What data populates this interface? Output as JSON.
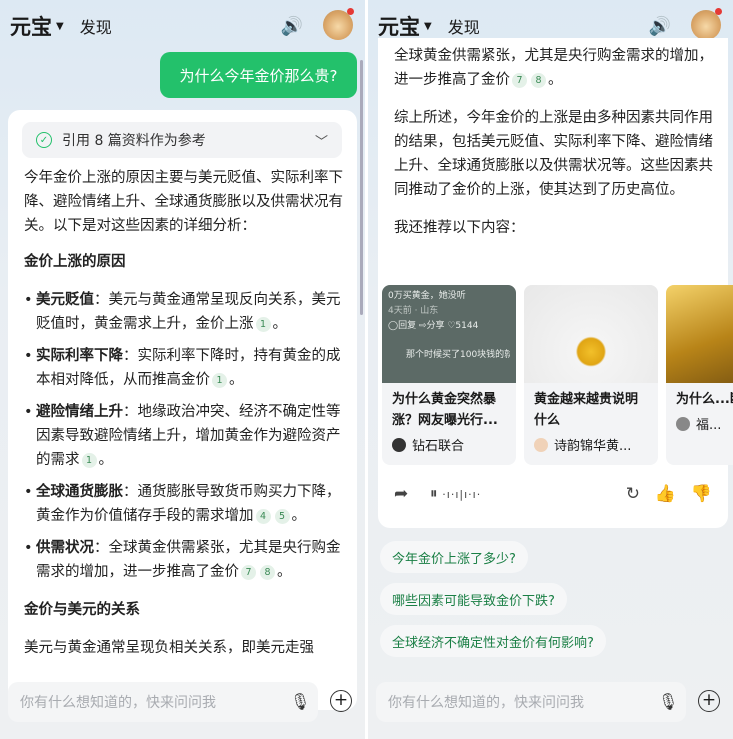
{
  "header": {
    "logo": "元宝",
    "discover": "发现"
  },
  "user_question": "为什么今年金价那么贵?",
  "reference": {
    "label": "引用 8 篇资料作为参考"
  },
  "intro": "今年金价上涨的原因主要与美元贬值、实际利率下降、避险情绪上升、全球通货膨胀以及供需状况有关。以下是对这些因素的详细分析：",
  "section1": "金价上涨的原因",
  "reasons": [
    {
      "title": "美元贬值",
      "text": "：美元与黄金通常呈现反向关系，美元贬值时，黄金需求上升，金价上涨",
      "cites": [
        "1"
      ]
    },
    {
      "title": "实际利率下降",
      "text": "：实际利率下降时，持有黄金的成本相对降低，从而推高金价",
      "cites": [
        "1"
      ]
    },
    {
      "title": "避险情绪上升",
      "text": "：地缘政治冲突、经济不确定性等因素导致避险情绪上升，增加黄金作为避险资产的需求",
      "cites": [
        "1"
      ]
    },
    {
      "title": "全球通货膨胀",
      "text": "：通货膨胀导致货币购买力下降，黄金作为价值储存手段的需求增加",
      "cites": [
        "4",
        "5"
      ]
    },
    {
      "title": "供需状况",
      "text": "：全球黄金供需紧张，尤其是央行购金需求的增加，进一步推高了金价",
      "cites": [
        "7",
        "8"
      ]
    }
  ],
  "section2": "金价与美元的关系",
  "section2_text": "美元与黄金通常呈现负相关关系，即美元走强",
  "right": {
    "top_text": "全球黄金供需紧张，尤其是央行购金需求的增加，进一步推高了金价",
    "top_cites": [
      "7",
      "8"
    ],
    "summary": "综上所述，今年金价的上涨是由多种因素共同作用的结果，包括美元贬值、实际利率下降、避险情绪上升、全球通货膨胀以及供需状况等。这些因素共同推动了金价的上涨，使其达到了历史高位。",
    "recommend_label": "我还推荐以下内容：",
    "cards": [
      {
        "title": "为什么黄金突然暴涨？网友曝光行...",
        "author": "钻石联合",
        "img_caption": "0万买黄金，她没听",
        "img_meta": "4天前 · 山东",
        "img_likes": "5144",
        "img_comment": "那个时候买了100块钱的就赚"
      },
      {
        "title": "黄金越来越贵说明什么",
        "author": "诗韵锦华黄..."
      },
      {
        "title": "为什么...断涨价",
        "author": "福..."
      }
    ],
    "suggestions": [
      "今年金价上涨了多少?",
      "哪些因素可能导致金价下跌?",
      "全球经济不确定性对金价有何影响?"
    ]
  },
  "input": {
    "placeholder": "你有什么想知道的，快来问问我"
  },
  "colors": {
    "accent": "#23c16b",
    "suggestion_text": "#1a7f45"
  }
}
